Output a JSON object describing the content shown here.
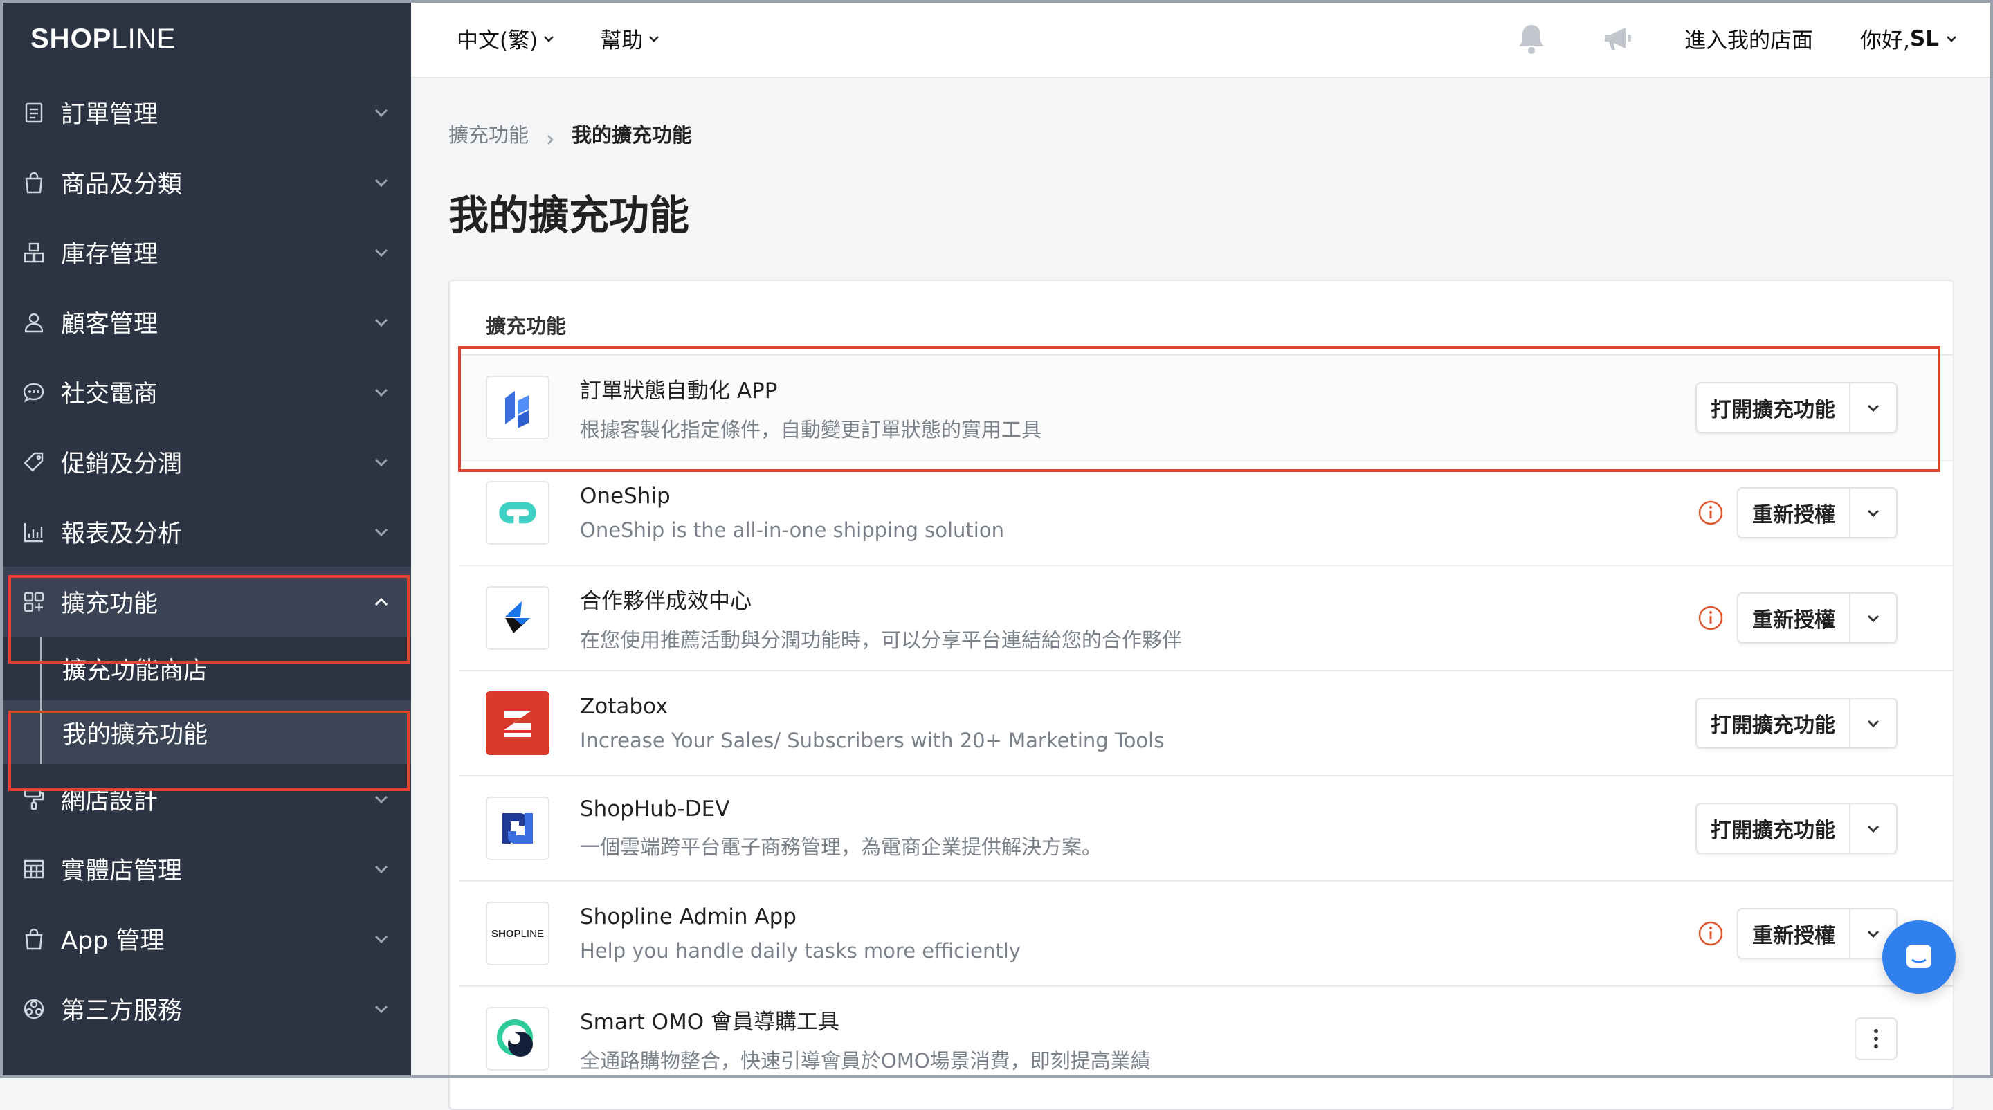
{
  "brand": {
    "logo_bold": "SHOP",
    "logo_thin": "LINE"
  },
  "sidebar": {
    "items": [
      {
        "label": "訂單管理",
        "icon": "order-icon"
      },
      {
        "label": "商品及分類",
        "icon": "bag-icon"
      },
      {
        "label": "庫存管理",
        "icon": "inventory-icon"
      },
      {
        "label": "顧客管理",
        "icon": "user-icon"
      },
      {
        "label": "社交電商",
        "icon": "chat-bubble-icon"
      },
      {
        "label": "促銷及分潤",
        "icon": "tag-icon"
      },
      {
        "label": "報表及分析",
        "icon": "chart-icon"
      },
      {
        "label": "擴充功能",
        "icon": "apps-icon"
      },
      {
        "label": "網店設計",
        "icon": "paint-roller-icon"
      },
      {
        "label": "實體店管理",
        "icon": "store-icon"
      },
      {
        "label": "App 管理",
        "icon": "bag-icon"
      },
      {
        "label": "第三方服務",
        "icon": "network-icon"
      }
    ],
    "subitems": [
      {
        "label": "擴充功能商店"
      },
      {
        "label": "我的擴充功能"
      }
    ]
  },
  "topbar": {
    "language": "中文(繁)",
    "help": "幫助",
    "enter_store": "進入我的店面",
    "greeting": "你好, ",
    "user": "SL"
  },
  "breadcrumb": {
    "parent": "擴充功能",
    "current": "我的擴充功能"
  },
  "page": {
    "title": "我的擴充功能"
  },
  "panel": {
    "title": "擴充功能"
  },
  "apps": [
    {
      "name": "訂單狀態自動化 APP",
      "desc": "根據客製化指定條件，自動變更訂單狀態的實用工具",
      "action": "打開擴充功能",
      "warning": false
    },
    {
      "name": "OneShip",
      "desc": "OneShip is the all-in-one shipping solution",
      "action": "重新授權",
      "warning": true
    },
    {
      "name": "合作夥伴成效中心",
      "desc": "在您使用推薦活動與分潤功能時，可以分享平台連結給您的合作夥伴",
      "action": "重新授權",
      "warning": true
    },
    {
      "name": "Zotabox",
      "desc": "Increase Your Sales/ Subscribers with 20+ Marketing Tools",
      "action": "打開擴充功能",
      "warning": false
    },
    {
      "name": "ShopHub-DEV",
      "desc": "一個雲端跨平台電子商務管理，為電商企業提供解決方案。",
      "action": "打開擴充功能",
      "warning": false
    },
    {
      "name": "Shopline Admin App",
      "desc": "Help you handle daily tasks more efficiently",
      "action": "重新授權",
      "warning": true
    },
    {
      "name": "Smart OMO 會員導購工具",
      "desc": "全通路購物整合，快速引導會員於OMO場景消費，即刻提高業績",
      "action": "",
      "warning": false
    }
  ],
  "mini_logo": {
    "bold": "SHOP",
    "thin": "LINE"
  },
  "colors": {
    "sidebar": "#2c3443",
    "highlight": "#e0442d",
    "accent": "#2f80ed",
    "warning": "#e0582f"
  }
}
